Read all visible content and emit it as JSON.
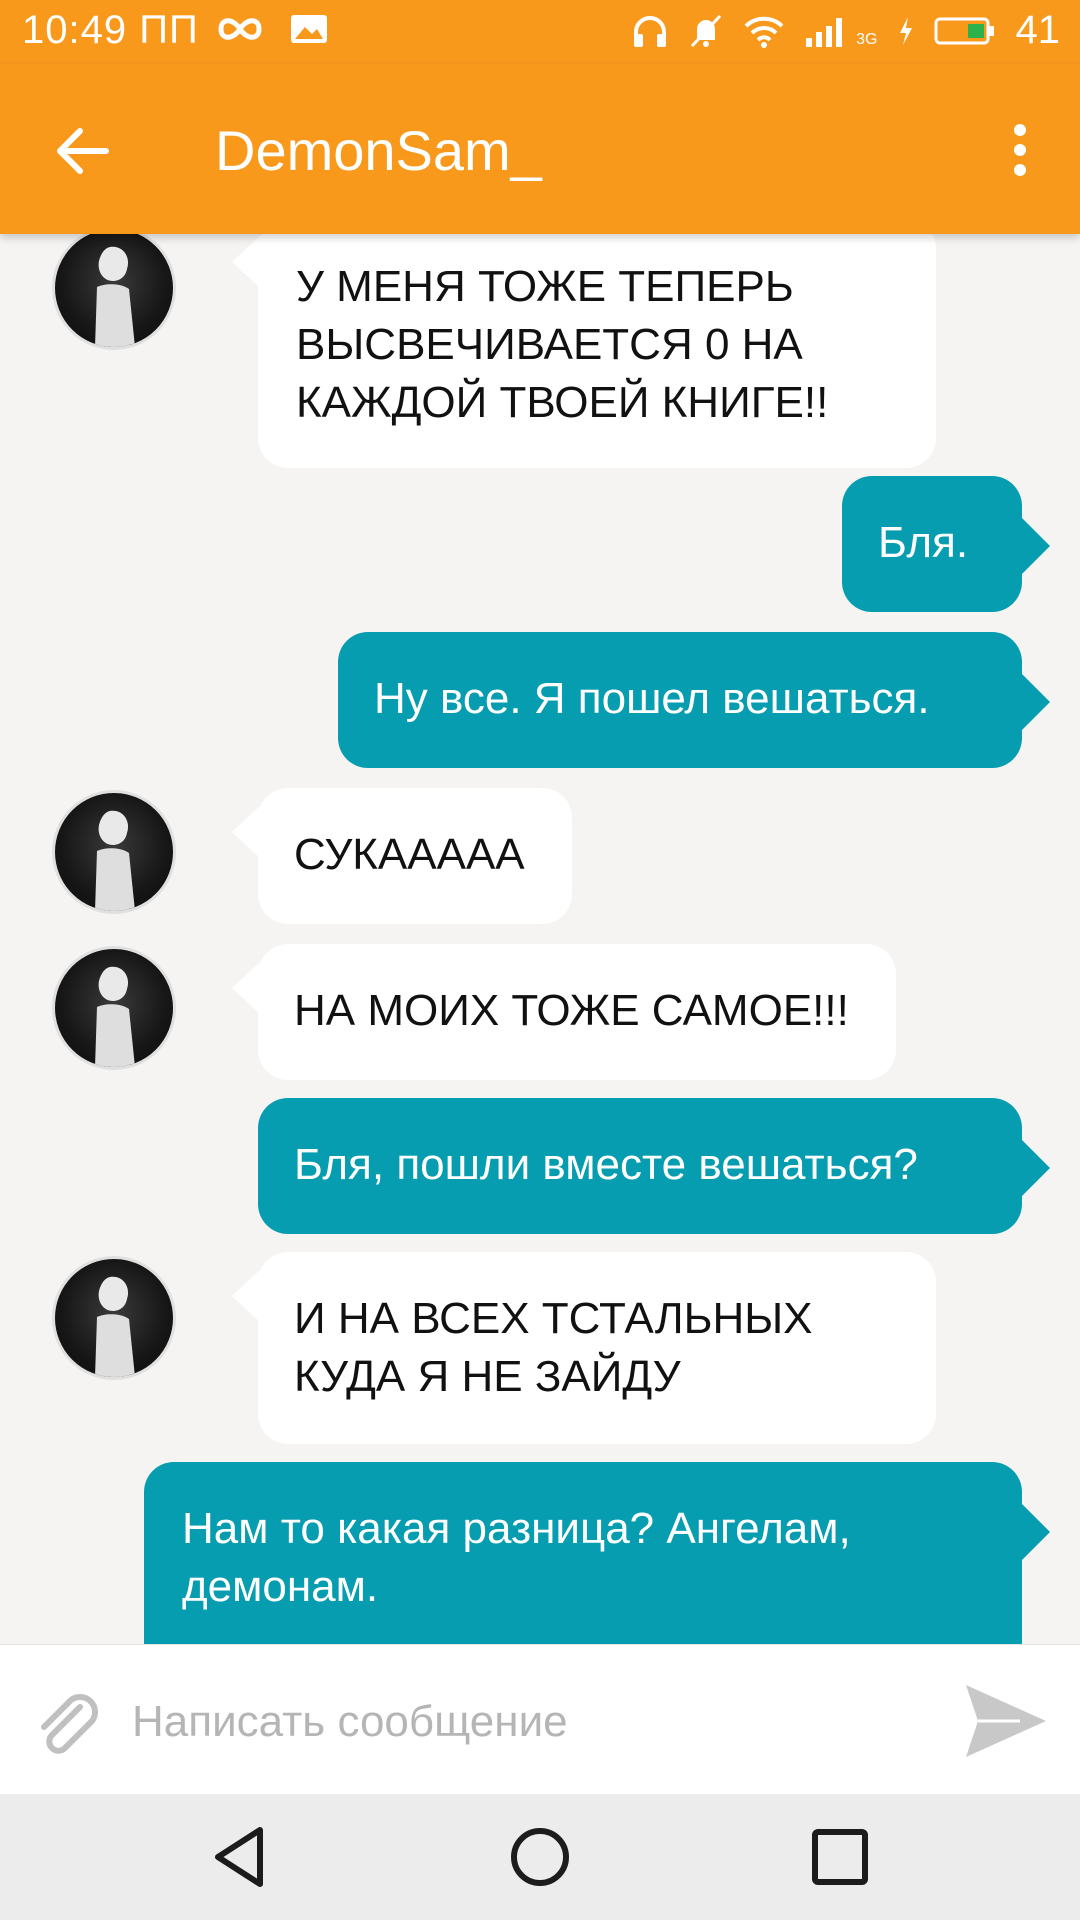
{
  "status_bar": {
    "time": "10:49 ПП",
    "network_type": "3G",
    "battery": "41",
    "icons": [
      "infinity-icon",
      "image-icon",
      "headphones-icon",
      "bell-muted-icon",
      "wifi-icon",
      "signal-icon",
      "charging-icon",
      "battery-icon"
    ]
  },
  "toolbar": {
    "title": "DemonSam_",
    "back_icon": "back-arrow-icon",
    "menu_icon": "more-vert-icon"
  },
  "colors": {
    "accent": "#f8991c",
    "outgoing_bubble": "#079db0",
    "incoming_bubble": "#ffffff",
    "background": "#f6f4f2"
  },
  "messages": [
    {
      "side": "in",
      "text": "У МЕНЯ ТОЖЕ ТЕПЕРЬ ВЫСВЕЧИВАЕТСЯ 0 НА КАЖДОЙ ТВОЕЙ КНИГЕ!!"
    },
    {
      "side": "out",
      "text": "Бля."
    },
    {
      "side": "out",
      "text": "Ну все. Я пошел вешаться."
    },
    {
      "side": "in",
      "text": "СУКААААА"
    },
    {
      "side": "in",
      "text": "НА МОИХ ТОЖЕ САМОЕ!!!"
    },
    {
      "side": "out",
      "text": "Бля, пошли вместе вешаться?"
    },
    {
      "side": "in",
      "text": "И НА ВСЕХ ТСТАЛЬНЫХ КУДА Я НЕ ЗАЙДУ"
    },
    {
      "side": "out",
      "text": "Нам то какая разница? Ангелам, демонам."
    }
  ],
  "composer": {
    "placeholder": "Написать сообщение",
    "attach_icon": "paperclip-icon",
    "send_icon": "send-icon"
  },
  "nav_bar": {
    "icons": [
      "nav-back-icon",
      "nav-home-icon",
      "nav-recents-icon"
    ]
  }
}
